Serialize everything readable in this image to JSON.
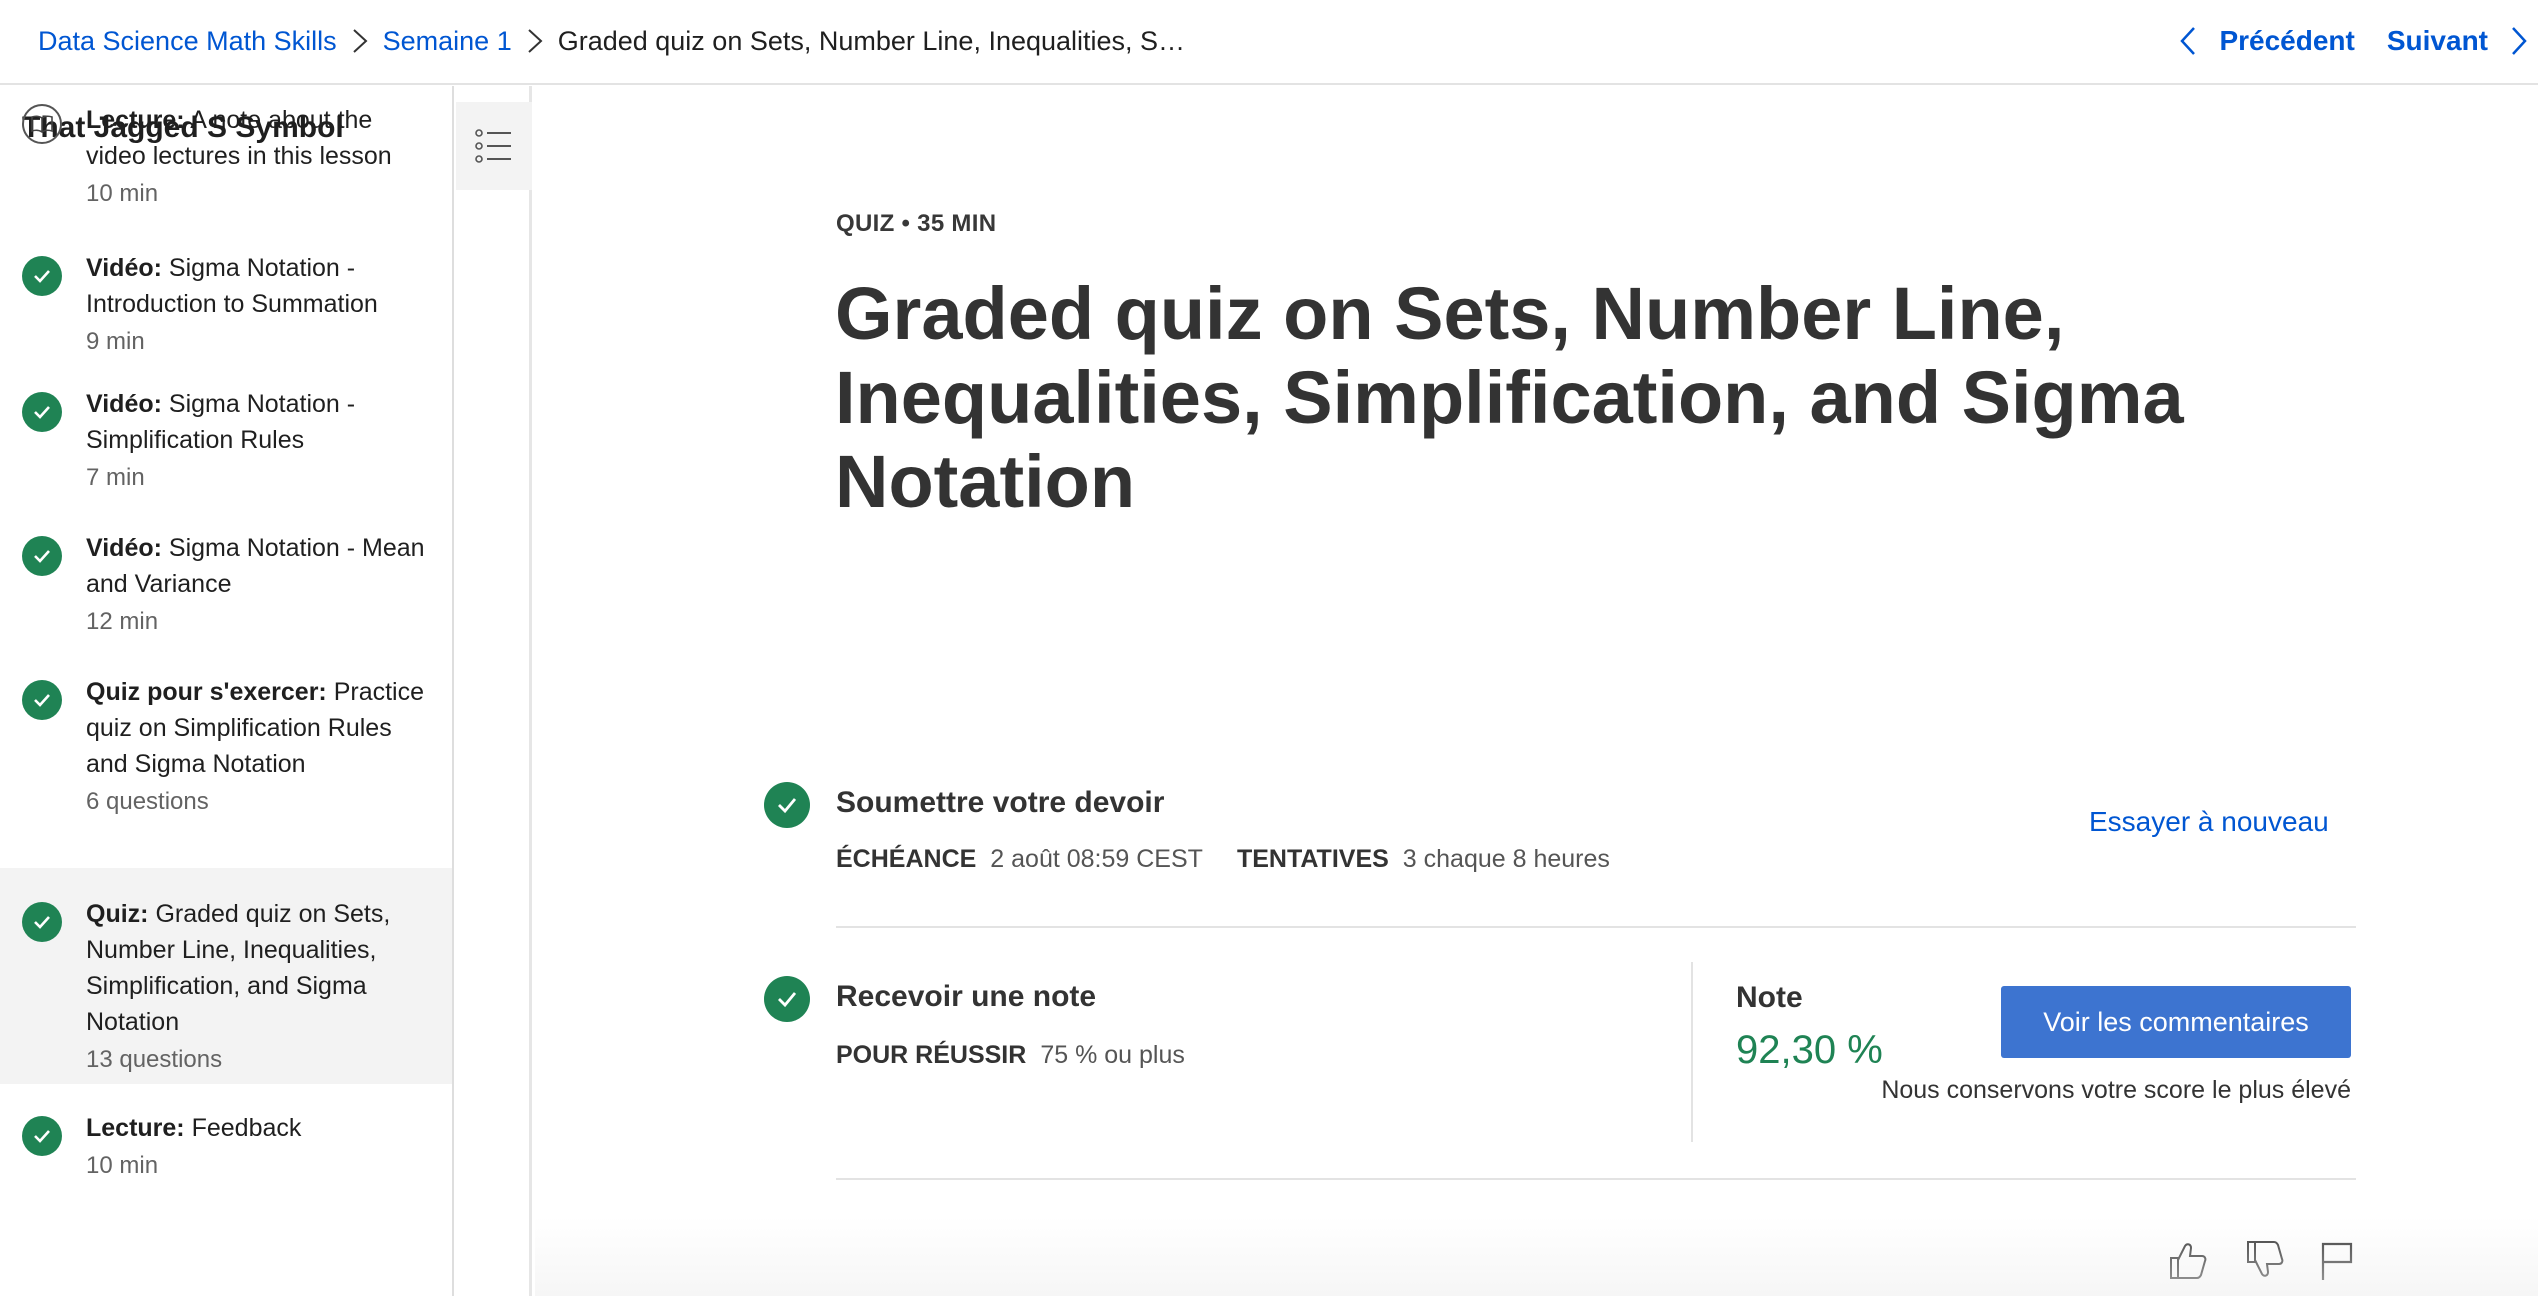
{
  "breadcrumb": {
    "course": "Data Science Math Skills",
    "week": "Semaine 1",
    "current": "Graded quiz on Sets, Number Line, Inequalities, S…"
  },
  "nav": {
    "prev_label": "Précédent",
    "next_label": "Suivant"
  },
  "sidebar": {
    "module_title": "That Jagged S Symbol",
    "items": [
      {
        "type": "Lecture:",
        "name": "A note about the video lectures in this lesson",
        "meta": "10 min",
        "icon": "book-icon",
        "completed": false
      },
      {
        "type": "Vidéo:",
        "name": "Sigma Notation - Introduction to Summation",
        "meta": "9 min",
        "icon": "check-circle-icon",
        "completed": true
      },
      {
        "type": "Vidéo:",
        "name": "Sigma Notation - Simplification Rules",
        "meta": "7 min",
        "icon": "check-circle-icon",
        "completed": true
      },
      {
        "type": "Vidéo:",
        "name": "Sigma Notation - Mean and Variance",
        "meta": "12 min",
        "icon": "check-circle-icon",
        "completed": true
      },
      {
        "type": "Quiz pour s'exercer:",
        "name": "Practice quiz on Simplification Rules and Sigma Notation",
        "meta": "6 questions",
        "icon": "check-circle-icon",
        "completed": true
      },
      {
        "type": "Quiz:",
        "name": "Graded quiz on Sets, Number Line, Inequalities, Simplification, and Sigma Notation",
        "meta": "13 questions",
        "icon": "check-circle-icon",
        "completed": true
      },
      {
        "type": "Lecture:",
        "name": "Feedback",
        "meta": "10 min",
        "icon": "check-circle-icon",
        "completed": true
      }
    ]
  },
  "main": {
    "kicker": "QUIZ • 35 MIN",
    "title": "Graded quiz on Sets, Number Line, Inequalities, Simplification, and Sigma Notation",
    "submit": {
      "title": "Soumettre votre devoir",
      "due_label": "ÉCHÉANCE",
      "due_value": "2 août 08:59 CEST",
      "attempts_label": "TENTATIVES",
      "attempts_value": "3 chaque 8 heures",
      "retry_label": "Essayer à nouveau"
    },
    "grade": {
      "title": "Recevoir une note",
      "pass_label": "POUR RÉUSSIR",
      "pass_value": "75 % ou plus",
      "grade_label": "Note",
      "grade_value": "92,30 %",
      "feedback_button": "Voir les commentaires",
      "keep_note": "Nous conservons votre score le plus élevé"
    }
  },
  "colors": {
    "link": "#0056d2",
    "success": "#1f8354",
    "button": "#3d74d0"
  }
}
